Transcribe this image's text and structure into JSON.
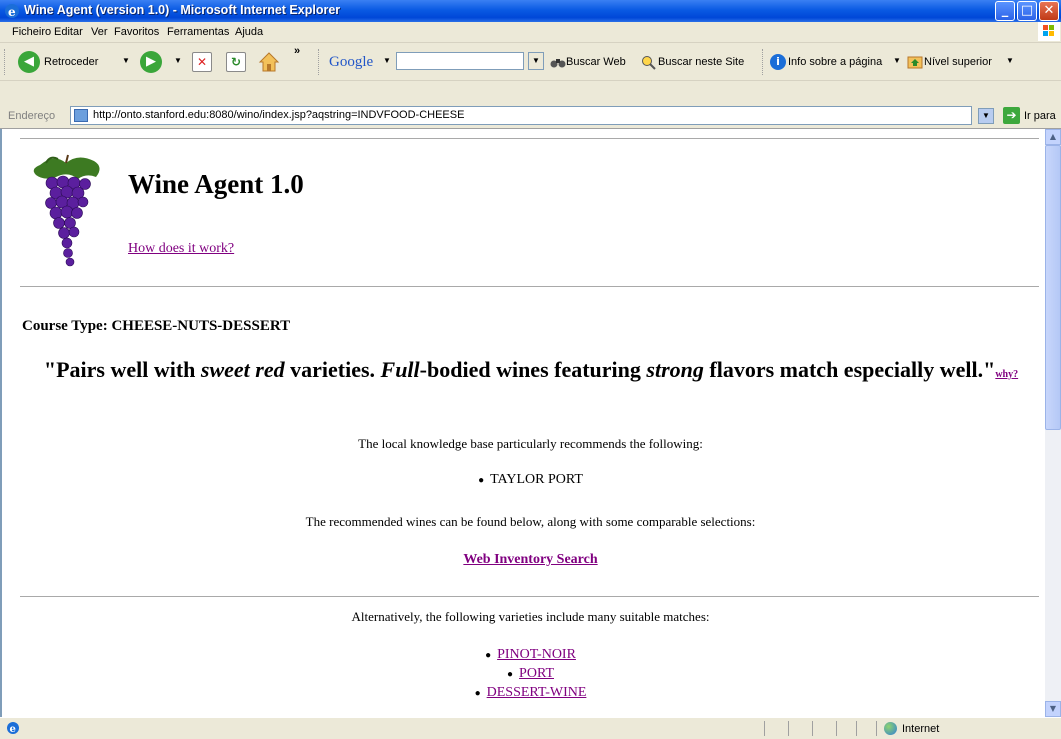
{
  "window": {
    "title": "Wine Agent (version 1.0) - Microsoft Internet Explorer",
    "controls": {
      "min": "_",
      "max": "□",
      "close": "✕"
    }
  },
  "menu": [
    "Ficheiro",
    "Editar",
    "Ver",
    "Favoritos",
    "Ferramentas",
    "Ajuda"
  ],
  "toolbar": {
    "back_label": "Retroceder",
    "more": "»",
    "google_label": "Google",
    "search_value": "",
    "buscar_web": "Buscar Web",
    "buscar_site": "Buscar neste Site",
    "info_pagina": "Info sobre a página",
    "nivel_superior": "Nível superior"
  },
  "address": {
    "label": "Endereço",
    "url": "http://onto.stanford.edu:8080/wino/index.jsp?aqstring=INDVFOOD-CHEESE",
    "go_label": "Ir para"
  },
  "page": {
    "heading": "Wine Agent 1.0",
    "how_link": "How does it work?",
    "course_type": "Course Type: CHEESE-NUTS-DESSERT",
    "quote": {
      "p1": "\"Pairs well with ",
      "e1": "sweet red",
      "p2": " varieties. ",
      "e2": "Full",
      "p3": "-bodied wines featuring ",
      "e3": "strong",
      "p4": " flavors match especially well.\"",
      "why": "why?"
    },
    "kb_text": "The local knowledge base particularly recommends the following:",
    "kb_items": [
      "TAYLOR PORT"
    ],
    "recommended_text": "The recommended wines can be found below, along with some comparable selections:",
    "inventory_link": "Web Inventory Search",
    "alt_text": "Alternatively, the following varieties include many suitable matches:",
    "varieties": [
      "PINOT-NOIR",
      "PORT",
      "DESSERT-WINE"
    ]
  },
  "status": {
    "zone": "Internet"
  },
  "colors": {
    "visited_link": "#800080",
    "title_bar": "#0a5ae3"
  }
}
